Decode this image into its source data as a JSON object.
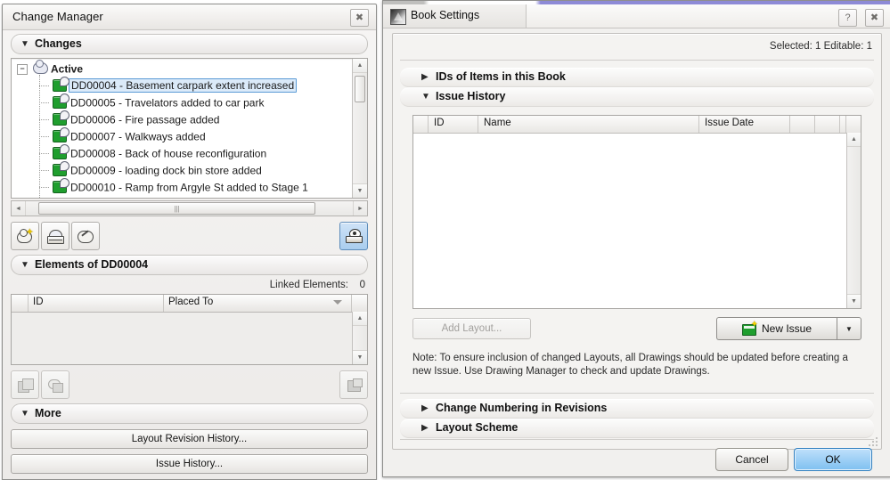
{
  "change_manager": {
    "title": "Change Manager",
    "close_icon": "close-icon",
    "sections": {
      "changes": {
        "label": "Changes",
        "triangle": "▼"
      },
      "elements": {
        "label": "Elements of DD00004",
        "triangle": "▼"
      },
      "more": {
        "label": "More",
        "triangle": "▼"
      }
    },
    "tree": {
      "root": {
        "label": "Active",
        "icon": "cloud-icon",
        "expander": "−"
      },
      "items": [
        {
          "label": "DD00004 - Basement carpark extent increased",
          "icon": "change-icon",
          "selected": true
        },
        {
          "label": "DD00005 - Travelators added to car park",
          "icon": "change-icon",
          "selected": false
        },
        {
          "label": "DD00006 - Fire passage added",
          "icon": "change-icon",
          "selected": false
        },
        {
          "label": "DD00007 - Walkways added",
          "icon": "change-icon",
          "selected": false
        },
        {
          "label": "DD00008 - Back of house reconfiguration",
          "icon": "change-icon",
          "selected": false
        },
        {
          "label": "DD00009 - loading dock bin store added",
          "icon": "change-icon",
          "selected": false
        },
        {
          "label": "DD00010 - Ramp from Argyle St added to Stage 1",
          "icon": "change-icon",
          "selected": false
        }
      ],
      "scroll": {
        "up_arrow": "▲",
        "down_arrow": "▼",
        "left_arrow": "◄",
        "right_arrow": "►",
        "grip": "|||"
      }
    },
    "toolbar": [
      {
        "name": "new-change-button",
        "icon": "cloud-star-icon",
        "enabled": true
      },
      {
        "name": "print-change-button",
        "icon": "printer-icon",
        "enabled": true
      },
      {
        "name": "edit-change-button",
        "icon": "cloud-pen-icon",
        "enabled": true
      },
      {
        "name": "show-change-button",
        "icon": "eye-stack-icon",
        "enabled": true,
        "active": true
      }
    ],
    "linked_elements": {
      "label": "Linked Elements:",
      "value": "0"
    },
    "elements_table": {
      "columns": [
        "ID",
        "Placed To"
      ],
      "rows": [],
      "sort_caret": "▼"
    },
    "element_toolbar": [
      {
        "name": "add-element-button",
        "icon": "element-plus-icon",
        "enabled": false
      },
      {
        "name": "remove-element-button",
        "icon": "element-minus-icon",
        "enabled": false
      },
      {
        "name": "select-element-button",
        "icon": "element-select-icon",
        "enabled": false
      }
    ],
    "more_buttons": [
      {
        "name": "layout-revision-history-button",
        "label": "Layout Revision History..."
      },
      {
        "name": "issue-history-button",
        "label": "Issue History..."
      }
    ]
  },
  "book_settings": {
    "title": "Book Settings",
    "app_icon": "archicad-icon",
    "help_icon": "help-icon",
    "close_icon": "close-icon",
    "selected_info": "Selected: 1 Editable: 1",
    "sections": [
      {
        "name": "ids-of-items-in-this-book",
        "label": "IDs of Items in this Book",
        "triangle": "▶",
        "expanded": false
      },
      {
        "name": "issue-history",
        "label": "Issue History",
        "triangle": "▼",
        "expanded": true
      },
      {
        "name": "change-numbering-in-revisions",
        "label": "Change Numbering in Revisions",
        "triangle": "▶",
        "expanded": false
      },
      {
        "name": "layout-scheme",
        "label": "Layout Scheme",
        "triangle": "▶",
        "expanded": false
      }
    ],
    "issue_table": {
      "columns": [
        "ID",
        "Name",
        "Issue Date",
        "",
        "",
        ""
      ],
      "rows": [],
      "scroll": {
        "up_arrow": "▲",
        "down_arrow": "▼"
      }
    },
    "add_layout_button": {
      "label": "Add Layout...",
      "enabled": false
    },
    "new_issue_button": {
      "label": "New Issue",
      "icon": "new-issue-icon",
      "dropdown_arrow": "▼"
    },
    "note": "Note: To ensure inclusion of changed Layouts, all Drawings should be updated before creating a new Issue. Use Drawing Manager to check and update Drawings.",
    "footer": {
      "cancel_label": "Cancel",
      "ok_label": "OK"
    }
  },
  "colors": {
    "accent_blue": "#7ec0f0",
    "selection_blue": "#dbeaf9",
    "selection_border": "#5b9bd5",
    "change_green": "#1f9e2e",
    "window_chrome": "#f0efee",
    "active_window_strip": "#8d8ad6"
  }
}
